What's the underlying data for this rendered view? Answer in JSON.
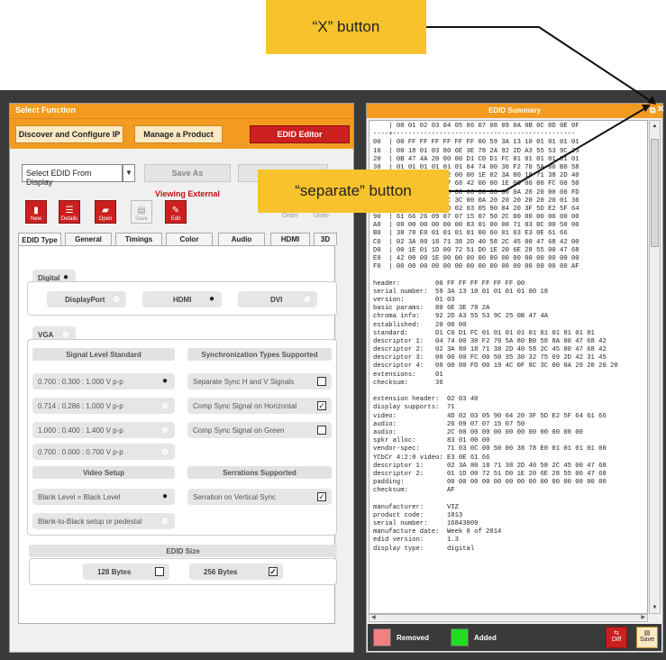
{
  "callouts": {
    "x_button": "“X” button",
    "separate_button": "“separate” button"
  },
  "left": {
    "title": "Select Function",
    "tabs": [
      "Discover and Configure IP",
      "Manage a Product",
      "EDID Editor"
    ],
    "select_value": "Select EDID From Display",
    "save_as": "Save As",
    "viewing": "Viewing External",
    "icons": [
      {
        "label": "New",
        "icon": "new-file-icon"
      },
      {
        "label": "Details",
        "icon": "details-icon"
      },
      {
        "label": "Open",
        "icon": "open-icon"
      },
      {
        "label": "Save",
        "icon": "save-icon"
      },
      {
        "label": "Edit",
        "icon": "edit-icon"
      }
    ],
    "ghost_btns": [
      "Order",
      "Undo"
    ],
    "subtabs": [
      "EDID Type",
      "General",
      "Timings",
      "Color",
      "Audio",
      "HDMI",
      "3D"
    ],
    "digital": "Digital",
    "displayport": "DisplayPort",
    "hdmi": "HDMI",
    "dvi": "DVI",
    "vga": "VGA",
    "signal_level_standard": "Signal Level Standard",
    "sync_types": "Synchronization Types Supported",
    "signal_levels": [
      "0.700 : 0.300 : 1.000 V p-p",
      "0.714 : 0.286 : 1.000 V p-p",
      "1.000 : 0.400 : 1.400 V p-p",
      "0.700 : 0.000 : 0.700 V p-p"
    ],
    "sync_options": [
      "Separate Sync H and V Signals",
      "Comp Sync Signal on Horizontal",
      "Comp Sync Signal on Green"
    ],
    "video_setup": "Video Setup",
    "serrations": "Serrations Supported",
    "blank_black": "Blank Level = Black Level",
    "serration_vs": "Serration on Vertical Sync",
    "blank_to_black": "Blank-to-Black setup or pedestal",
    "edid_size": "EDID Size",
    "size_128": "128 Bytes",
    "size_256": "256 Bytes"
  },
  "right": {
    "title": "EDID Summary",
    "hex_lines": [
      "    | 00 01 02 03 04 05 06 07 08 09 0A 0B 0C 0D 0E 0F",
      "----+-----------------------------------------------",
      "00  | 00 FF FF FF FF FF FF 00 59 3A 13 10 01 01 01 01",
      "10  | 00 18 01 03 80 6E 3E 78 2A 92 2D A3 55 53 9C 25",
      "20  | 0B 47 4A 20 00 00 D1 C0 D1 FC 01 01 01 01 01 01",
      "30  | 01 01 01 01 01 01 04 74 00 30 F2 70 5A 80 B0 58",
      "40  | 8A 00 47 68 42 00 00 1E 02 3A 80 18 71 38 2D 40",
      "50  | 58 2C 45 00 47 68 42 00 00 1E 00 00 00 FC 00 50",
      "60  | 00 00 00 00 00 00 00 00 00 00 0A 20 20 00 00 FD",
      "70  | 00 19 4C 0F 8C 3C 00 0A 20 20 20 20 20 20 01 36",
      "80  | 02 03 40 71 4D 02 03 05 90 04 20 3F 5D E2 5F 64",
      "90  | 61 66 26 09 07 07 15 07 50 2C 00 00 00 00 00 00",
      "A0  | 00 00 00 00 00 00 83 01 00 00 71 03 0C 00 50 00",
      "B0  | 38 78 E0 01 01 01 01 00 60 01 03 E3 0E 61 66",
      "C0  | 02 3A 80 18 71 38 2D 40 58 2C 45 00 47 68 42 00",
      "D0  | 00 1E 01 1D 00 72 51 D0 1E 20 6E 28 55 00 47 68",
      "E0  | 42 00 00 1E 00 00 00 00 00 00 00 00 00 00 00 00",
      "F0  | 00 00 00 00 00 00 00 00 00 00 00 00 00 00 00 AF"
    ],
    "summary_lines": [
      "",
      "header:         00 FF FF FF FF FF FF 00",
      "serial number:  59 3A 13 10 01 01 01 01 00 18",
      "version:        01 03",
      "basic params:   80 6E 3E 78 2A",
      "chroma info:    92 2D A3 55 53 9C 25 0B 47 4A",
      "established:    20 00 00",
      "standard:       D1 C0 D1 FC 01 01 01 01 01 01 01 01 01 01",
      "descriptor 1:   04 74 00 30 F2 70 5A 80 B0 58 8A 00 47 68 42",
      "descriptor 2:   02 3A 80 18 71 38 2D 40 58 2C 45 00 47 68 42",
      "descriptor 3:   00 00 00 FC 00 50 35 30 32 75 69 2D 42 31 45",
      "descriptor 4:   00 00 00 FD 00 19 4C 0F 8C 3C 00 0A 20 20 20 20",
      "extensions:     01",
      "checksum:       36",
      "",
      "extension header:  02 03 40",
      "display supports:  71",
      "video:             4D 02 03 05 90 04 20 3F 5D E2 5F 64 61 66",
      "audio:             26 09 07 07 15 07 50",
      "audio:             2C 00 00 00 00 00 00 00 00 00 00 00",
      "spkr alloc:        83 01 00 00",
      "vendor-spec:       71 03 0C 00 50 00 38 78 E0 01 01 01 01 00",
      "YCbCr 4:2:0 video: E3 0E 61 66",
      "descriptor 1:      02 3A 80 18 71 38 2D 40 58 2C 45 00 47 68",
      "descriptor 2:      01 1D 00 72 51 D0 1E 20 6E 28 55 00 47 68",
      "padding:           00 00 00 00 00 00 00 00 00 00 00 00 00 00",
      "checksum:          AF",
      "",
      "manufacturer:      VIZ",
      "product code:      1013",
      "serial number:     16843009",
      "manufacture date:  Week 0 of 2014",
      "edid version:      1.3",
      "display type:      digital"
    ],
    "removed": "Removed",
    "added": "Added",
    "diff": "Diff",
    "save": "Save",
    "colors": {
      "removed": "#f28080",
      "added": "#22dd22"
    }
  }
}
